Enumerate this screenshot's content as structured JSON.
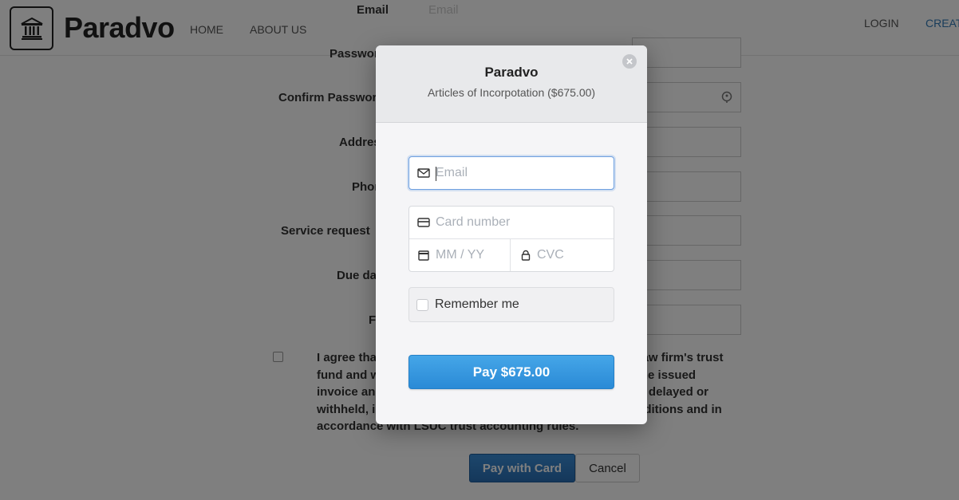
{
  "navbar": {
    "brand": "Paradvo",
    "home": "HOME",
    "about": "ABOUT US",
    "login": "LOGIN",
    "create": "CREATE"
  },
  "form": {
    "email_label": "Email",
    "email_placeholder": "Email",
    "password_label": "Password",
    "confirm_password_label": "Confirm Password",
    "address_label": "Address",
    "phone_label": "Phone",
    "service_label": "Service request",
    "due_label": "Due date",
    "fee_label": "Fee",
    "agree_text": "I agree that the funds will be deposited into the selected law firm's trust fund and will be released to the law firm upon receipt of the issued invoice and completion of the services. The funds may be delayed or withheld, in accordance with the law firm's terms and conditions and in accordance with LSUC trust accounting rules.",
    "pay_with_card": "Pay with Card",
    "cancel": "Cancel"
  },
  "modal": {
    "title": "Paradvo",
    "subtitle": "Articles of Incorpotation ($675.00)",
    "email_placeholder": "Email",
    "card_placeholder": "Card number",
    "expiry_placeholder": "MM / YY",
    "cvc_placeholder": "CVC",
    "remember_label": "Remember me",
    "pay_button": "Pay $675.00"
  },
  "colors": {
    "pay_button": "#3a9ae0",
    "link_blue": "#337ab7",
    "focus_border": "#6d9fe0"
  },
  "icons": [
    "bank-icon",
    "close-icon",
    "mail-icon",
    "credit-card-icon",
    "calendar-icon",
    "lock-icon"
  ]
}
